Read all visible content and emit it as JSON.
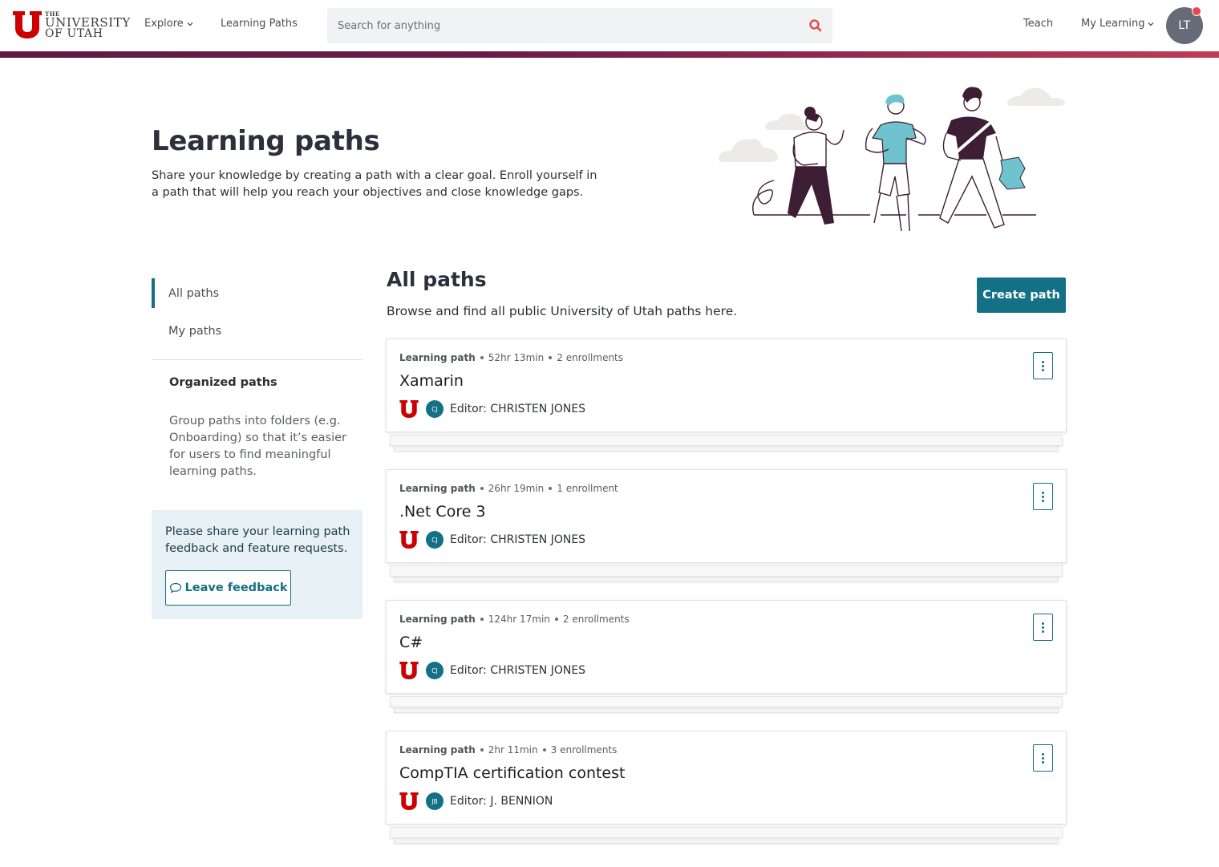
{
  "header": {
    "logo": {
      "the": "THE",
      "line1": "UNIVERSITY",
      "line2": "OF UTAH"
    },
    "nav": {
      "explore": "Explore",
      "learning_paths": "Learning Paths",
      "teach": "Teach",
      "my_learning": "My Learning"
    },
    "search": {
      "placeholder": "Search for anything",
      "value": ""
    },
    "avatar_initials": "LT"
  },
  "hero": {
    "title": "Learning paths",
    "description": "Share your knowledge by creating a path with a clear goal. Enroll yourself in a path that will help you reach your objectives and close knowledge gaps."
  },
  "sidebar": {
    "items": [
      {
        "label": "All paths",
        "active": true
      },
      {
        "label": "My paths",
        "active": false
      }
    ],
    "organized": {
      "title": "Organized paths",
      "description": "Group paths into folders (e.g. Onboarding) so that it’s easier for users to find meaningful learning paths."
    },
    "feedback": {
      "text": "Please share your learning path feedback and feature requests.",
      "button": "Leave feedback"
    }
  },
  "main": {
    "title": "All paths",
    "description": "Browse and find all public University of Utah paths here.",
    "create_button": "Create path",
    "paths": [
      {
        "type": "Learning path",
        "duration": "52hr 13min",
        "enrollments": "2 enrollments",
        "title": "Xamarin",
        "editor_initials": "CJ",
        "editor": "Editor: CHRISTEN JONES"
      },
      {
        "type": "Learning path",
        "duration": "26hr 19min",
        "enrollments": "1 enrollment",
        "title": ".Net Core 3",
        "editor_initials": "CJ",
        "editor": "Editor: CHRISTEN JONES"
      },
      {
        "type": "Learning path",
        "duration": "124hr 17min",
        "enrollments": "2 enrollments",
        "title": "C#",
        "editor_initials": "CJ",
        "editor": "Editor: CHRISTEN JONES"
      },
      {
        "type": "Learning path",
        "duration": "2hr 11min",
        "enrollments": "3 enrollments",
        "title": "CompTIA certification contest",
        "editor_initials": "JB",
        "editor": "Editor: J. BENNION"
      }
    ]
  },
  "colors": {
    "brand_teal": "#137085",
    "utah_red": "#cc0000",
    "accent_plum": "#6a1b4d",
    "notification": "#e9484f"
  }
}
